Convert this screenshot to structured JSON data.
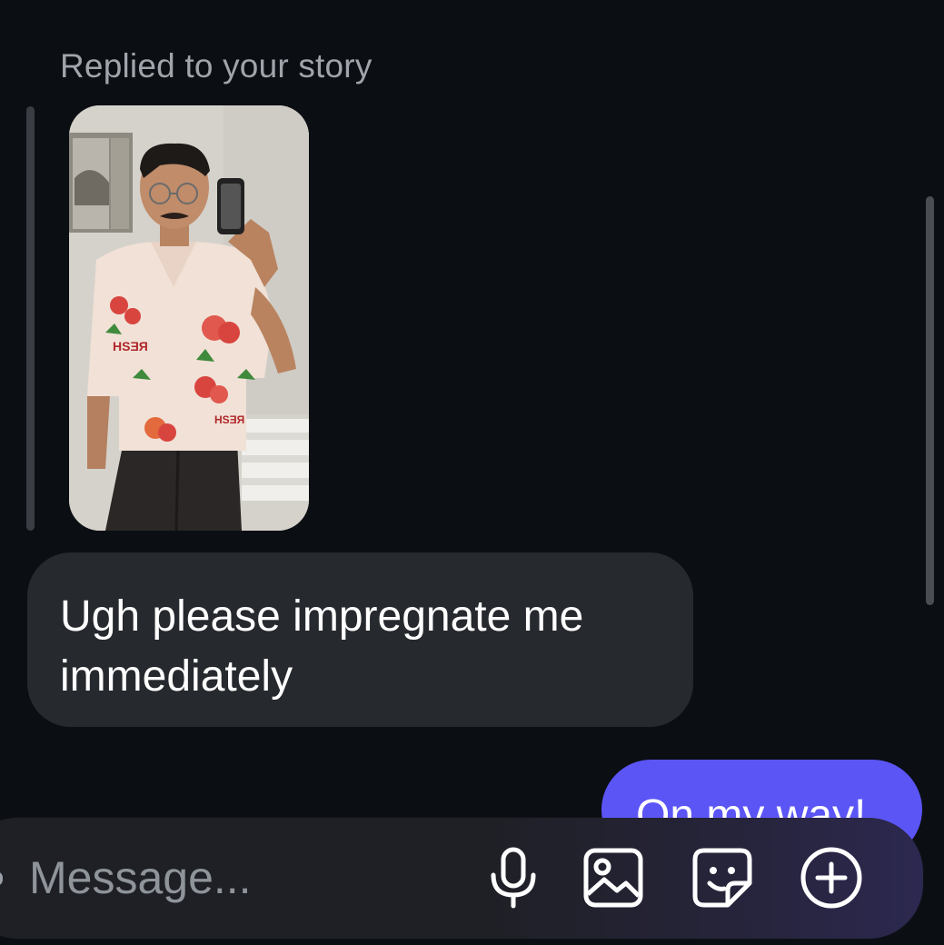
{
  "story_reply": {
    "label": "Replied to your story",
    "thumbnail_icon": "story-photo"
  },
  "messages": [
    {
      "direction": "incoming",
      "text_line1": "Ugh please impregnate me",
      "text_line2": "immediately"
    },
    {
      "direction": "outgoing",
      "text": "On my way!"
    }
  ],
  "composer": {
    "placeholder": "Message...",
    "icons": [
      "microphone-icon",
      "image-icon",
      "sticker-icon",
      "add-circle-icon"
    ]
  },
  "colors": {
    "background": "#0b0e13",
    "incoming_bubble": "#26292e",
    "outgoing_bubble": "#5b55f6",
    "secondary_text": "#a0a4ab"
  }
}
